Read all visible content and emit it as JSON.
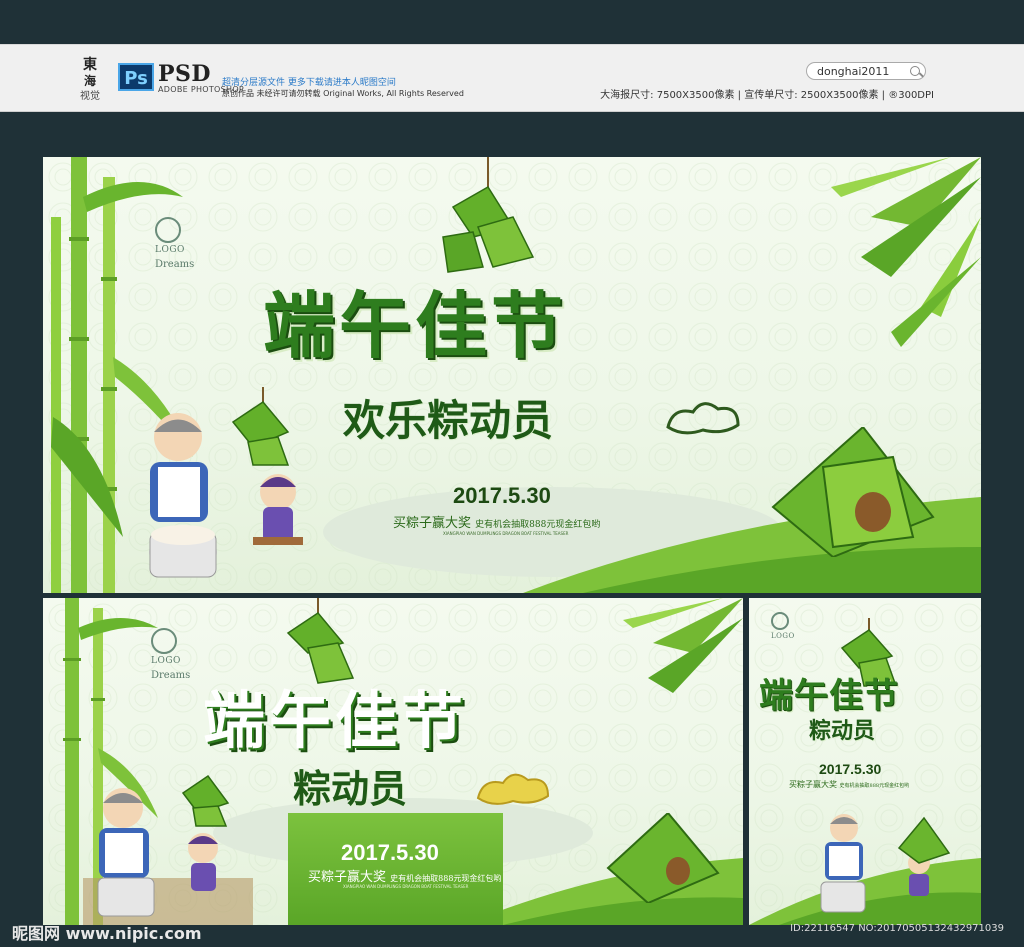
{
  "header": {
    "badge": "Ps",
    "product": "PSD",
    "product_sub": "ADOBE PHOTOSHOP",
    "tag_line1": "超清分层源文件  更多下载请进本人昵图空间",
    "tag_line2": "原创作品  未经许可请勿转载  Original Works, All Rights Reserved",
    "search_user": "donghai2011",
    "spec": "大海报尺寸: 7500X3500像素 | 宣传单尺寸: 2500X3500像素 | ®300DPI"
  },
  "banner1": {
    "logo_label": "LOGO",
    "dreams": "Dreams",
    "title": "端午佳节",
    "subtitle": "欢乐粽动员",
    "date": "2017.5.30",
    "promo_prefix": "买粽子赢大奖",
    "promo_main": "史有机会抽取888元现金红包哟",
    "tiny_en": "XIANGPIAO WAN DUMPLINGS DRAGON BOAT FESTIVAL TEASER"
  },
  "banner2": {
    "logo_label": "LOGO",
    "dreams": "Dreams",
    "title": "端午佳节",
    "subtitle": "粽动员",
    "date": "2017.5.30",
    "promo_prefix": "买粽子赢大奖",
    "promo_main": "史有机会抽取888元现金红包哟",
    "tiny_en": "XIANGPIAO WAN DUMPLINGS DRAGON BOAT FESTIVAL TEASER"
  },
  "banner3": {
    "logo_label": "LOGO",
    "title": "端午佳节",
    "subtitle": "粽动员",
    "date": "2017.5.30",
    "promo_prefix": "买粽子赢大奖",
    "promo_main": "史有机会抽取888元现金红包哟"
  },
  "footer": {
    "watermark": "昵图网 www.nipic.com",
    "id": "ID:22116547 NO:20170505132432971039"
  },
  "colors": {
    "background": "#1f3137",
    "title_green": "#2e7d1e",
    "accent_green": "#5aa627"
  }
}
